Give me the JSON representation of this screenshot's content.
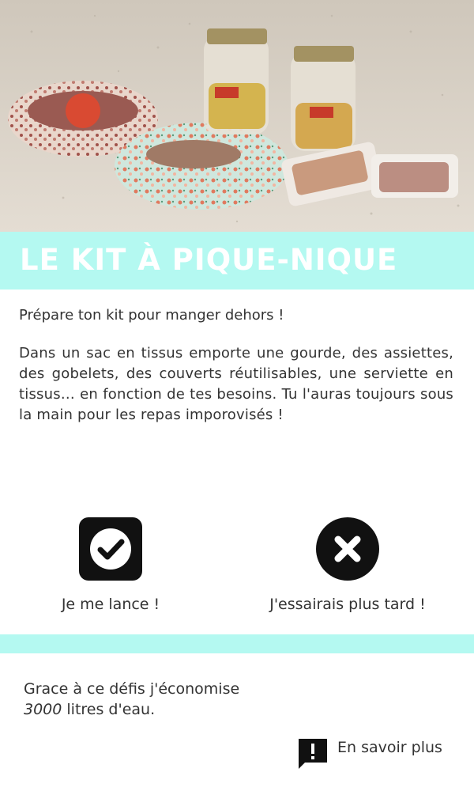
{
  "header": {
    "title": "LE KIT À PIQUE-NIQUE",
    "image_alt": "picnic-kit-photo"
  },
  "content": {
    "intro": "Prépare ton kit pour manger dehors !",
    "body": "Dans un sac en tissus emporte une gourde,  des assiettes, des gobelets, des couverts réutilisables, une serviette en tissus… en fonction de tes besoins. Tu l'auras toujours sous la main pour les repas imporovisés !"
  },
  "actions": {
    "accept_label": "Je me lance !",
    "accept_icon": "check-icon",
    "decline_label": "J'essairais plus tard !",
    "decline_icon": "close-icon"
  },
  "footer": {
    "saving_prefix": "Grace à ce défis j'économise",
    "saving_value": "3000",
    "saving_suffix": " litres d'eau.",
    "more_label": "En savoir plus",
    "more_icon": "feedback-icon"
  },
  "colors": {
    "accent": "#b4f9f1",
    "icon": "#111111",
    "text": "#333333"
  }
}
